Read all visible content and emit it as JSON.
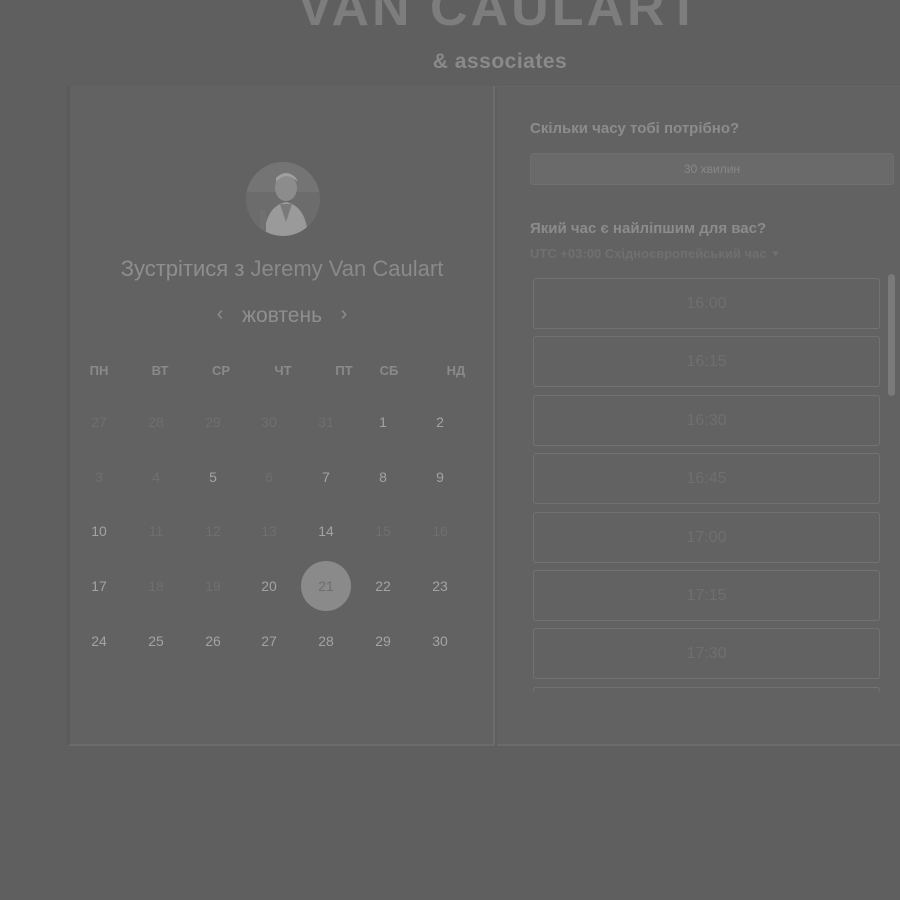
{
  "brand": {
    "title": "VAN CAULART",
    "subtitle": "& associates"
  },
  "host": {
    "meet_prefix": "Зустрітися з ",
    "name": "Jeremy Van Caulart"
  },
  "calendar": {
    "month": "жовтень",
    "prev_icon": "chevron-left-icon",
    "next_icon": "chevron-right-icon",
    "weekdays": [
      "ПН",
      "ВТ",
      "СР",
      "ЧТ",
      "ПТ",
      "СБ",
      "НД"
    ],
    "weeks": [
      [
        {
          "d": "27",
          "s": "muted"
        },
        {
          "d": "28",
          "s": "muted"
        },
        {
          "d": "29",
          "s": "muted"
        },
        {
          "d": "30",
          "s": "muted"
        },
        {
          "d": "31",
          "s": "muted"
        },
        {
          "d": "1",
          "s": "active"
        },
        {
          "d": "2",
          "s": "active"
        }
      ],
      [
        {
          "d": "3",
          "s": "muted"
        },
        {
          "d": "4",
          "s": "muted"
        },
        {
          "d": "5",
          "s": "active"
        },
        {
          "d": "6",
          "s": "muted"
        },
        {
          "d": "7",
          "s": "active"
        },
        {
          "d": "8",
          "s": "active"
        },
        {
          "d": "9",
          "s": "active"
        }
      ],
      [
        {
          "d": "10",
          "s": "active"
        },
        {
          "d": "11",
          "s": "muted"
        },
        {
          "d": "12",
          "s": "muted"
        },
        {
          "d": "13",
          "s": "muted"
        },
        {
          "d": "14",
          "s": "active"
        },
        {
          "d": "15",
          "s": "muted"
        },
        {
          "d": "16",
          "s": "muted"
        }
      ],
      [
        {
          "d": "17",
          "s": "active"
        },
        {
          "d": "18",
          "s": "muted"
        },
        {
          "d": "19",
          "s": "muted"
        },
        {
          "d": "20",
          "s": "active"
        },
        {
          "d": "21",
          "s": "selected"
        },
        {
          "d": "22",
          "s": "active"
        },
        {
          "d": "23",
          "s": "active"
        }
      ],
      [
        {
          "d": "24",
          "s": "active"
        },
        {
          "d": "25",
          "s": "active"
        },
        {
          "d": "26",
          "s": "active"
        },
        {
          "d": "27",
          "s": "active"
        },
        {
          "d": "28",
          "s": "active"
        },
        {
          "d": "29",
          "s": "active"
        },
        {
          "d": "30",
          "s": "active"
        }
      ]
    ]
  },
  "booking": {
    "duration_question": "Скільки часу тобі потрібно?",
    "duration_value": "30 хвилин",
    "time_question": "Який час є найліпшим для вас?",
    "timezone": "UTC +03:00 Східноєвропейський час",
    "timezone_icon": "caret-down-icon",
    "slots": [
      "16:00",
      "16:15",
      "16:30",
      "16:45",
      "17:00",
      "17:15",
      "17:30",
      ""
    ]
  }
}
